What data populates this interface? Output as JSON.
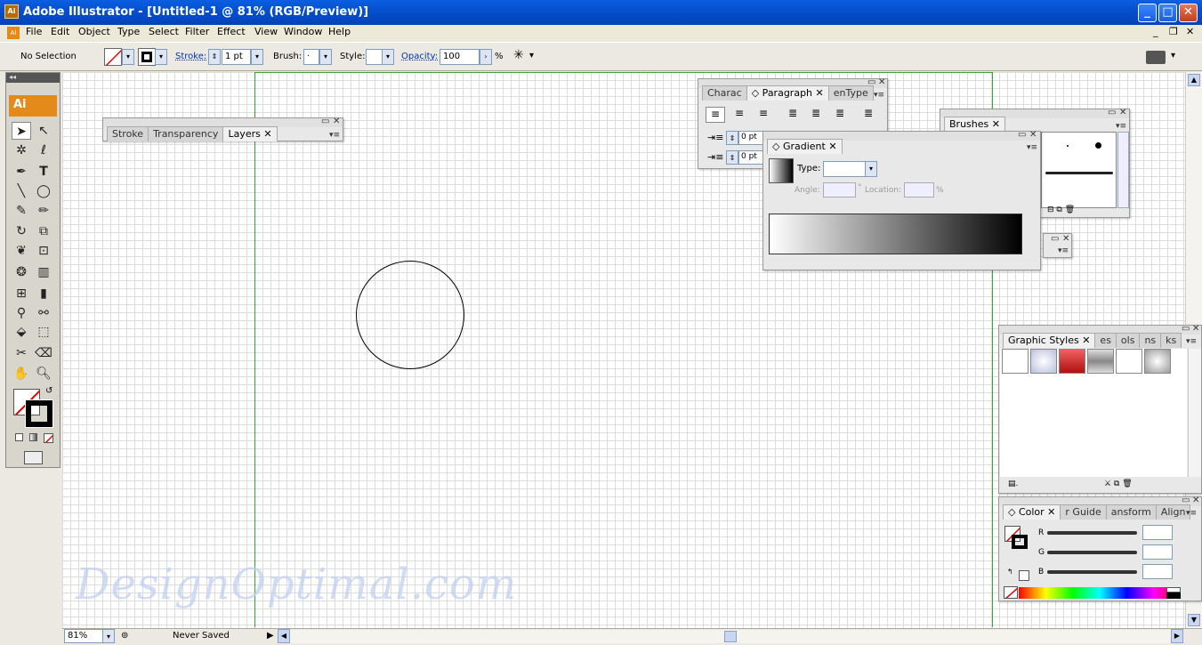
{
  "window": {
    "title": "Adobe Illustrator - [Untitled-1 @ 81% (RGB/Preview)]",
    "app_icon": "Ai",
    "min": "_",
    "max": "□",
    "close": "✕"
  },
  "menu": [
    "File",
    "Edit",
    "Object",
    "Type",
    "Select",
    "Filter",
    "Effect",
    "View",
    "Window",
    "Help"
  ],
  "mdi": {
    "min": "_",
    "restore": "❐",
    "close": "✕"
  },
  "control": {
    "selection": "No Selection",
    "stroke_label": "Stroke:",
    "stroke_value": "1 pt",
    "brush_label": "Brush:",
    "brush_value": "·",
    "style_label": "Style:",
    "opacity_label": "Opacity:",
    "opacity_value": "100",
    "opacity_unit": "%"
  },
  "toolbox": {
    "logo": "Ai",
    "collapse": "◂◂"
  },
  "panels": {
    "layers": {
      "tabs": [
        "Stroke",
        "Transparency",
        "Layers"
      ],
      "active": "Layers"
    },
    "paragraph": {
      "tabs": [
        "Charac",
        "◇ Paragraph",
        "enType"
      ],
      "active": "◇ Paragraph",
      "indent_left": "0 pt",
      "indent_first": "0 pt"
    },
    "brushes": {
      "tabs": [
        "Brushes"
      ]
    },
    "gradient": {
      "tab": "◇ Gradient",
      "type_label": "Type:",
      "angle_label": "Angle:",
      "degree": "°",
      "location_label": "Location:",
      "percent": "%"
    },
    "graphic_styles": {
      "tabs": [
        "Graphic Styles",
        "es",
        "ols",
        "ns",
        "ks"
      ]
    },
    "color": {
      "tabs": [
        "◇ Color",
        "r Guide",
        "ansform",
        "Align"
      ],
      "r": "R",
      "g": "G",
      "b": "B"
    }
  },
  "status": {
    "zoom": "81%",
    "save_state": "Never Saved"
  },
  "watermark": "DesignOptimal.com",
  "colors": {
    "title_bar": "#0550d0",
    "artboard_border": "#3aa03a",
    "logo": "#e48a1a"
  }
}
